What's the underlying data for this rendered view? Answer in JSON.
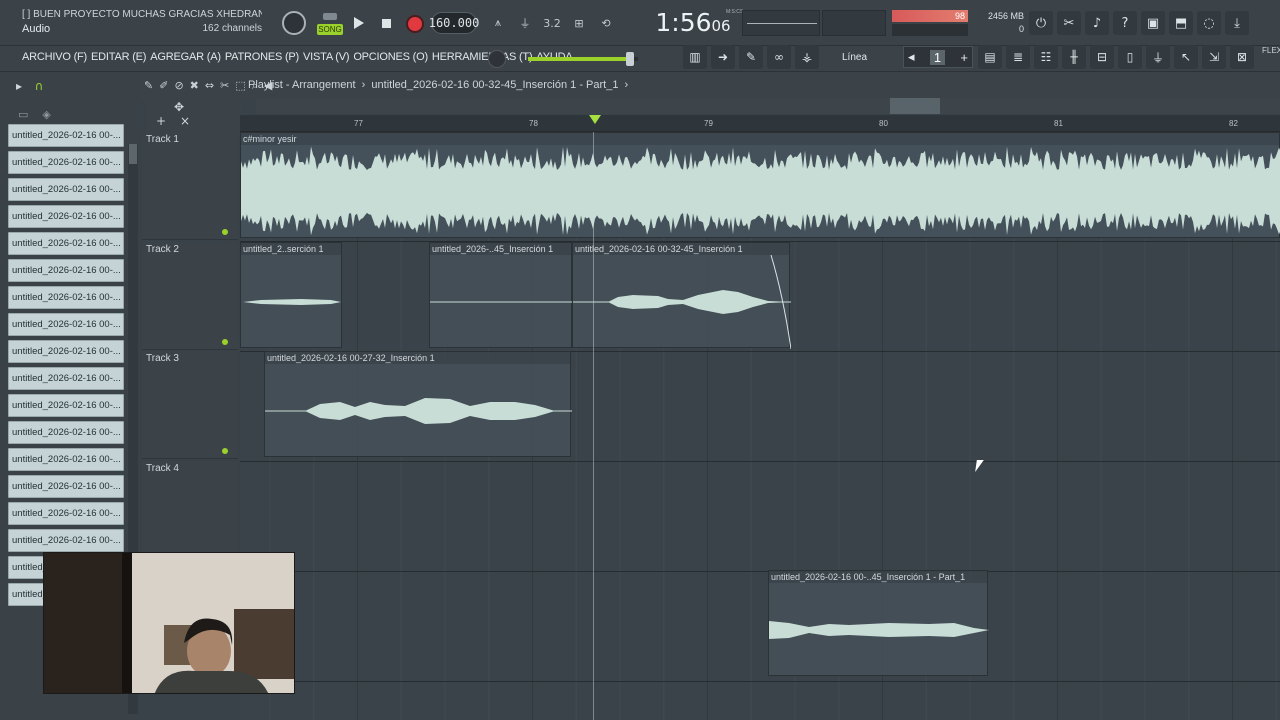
{
  "hint": {
    "line1": "[  ]  BUEN PROYECTO MUCHAS GRACIAS XHEDRAN.",
    "kind": "Audio",
    "channels": "162 channels"
  },
  "transport": {
    "mode_label": "SONG",
    "tempo": "160.000",
    "time_main": "1:56",
    "time_sub": "06",
    "time_unit": "M:S:CS"
  },
  "status": {
    "cpu_value": "98",
    "memory": "2456 MB",
    "polyphony": "0"
  },
  "menu": {
    "items": [
      "ARCHIVO (F)",
      "EDITAR (E)",
      "AGREGAR (A)",
      "PATRONES (P)",
      "VISTA (V)",
      "OPCIONES (O)",
      "HERRAMIENTAS (T)",
      "AYUDA"
    ]
  },
  "snap": {
    "label": "Línea",
    "step_value": "1"
  },
  "flex_label": "FLEX",
  "playlist": {
    "title": "Playlist - Arrangement",
    "breadcrumb": "untitled_2026-02-16 00-32-45_Inserción 1 - Part_1"
  },
  "browser": {
    "items": [
      "untitled_2026-02-16 00-...",
      "untitled_2026-02-16 00-...",
      "untitled_2026-02-16 00-...",
      "untitled_2026-02-16 00-...",
      "untitled_2026-02-16 00-...",
      "untitled_2026-02-16 00-...",
      "untitled_2026-02-16 00-...",
      "untitled_2026-02-16 00-...",
      "untitled_2026-02-16 00-...",
      "untitled_2026-02-16 00-...",
      "untitled_2026-02-16 00-...",
      "untitled_2026-02-16 00-...",
      "untitled_2026-02-16 00-...",
      "untitled_2026-02-16 00-...",
      "untitled_2026-02-16 00-...",
      "untitled_2026-02-16 00-...",
      "untitled_2026-02-16 00-...",
      "untitled_2026-02-16 00-..."
    ]
  },
  "ruler": {
    "bars": [
      "77",
      "78",
      "79",
      "80",
      "81",
      "82"
    ]
  },
  "tracks": [
    {
      "name": "Track 1"
    },
    {
      "name": "Track 2"
    },
    {
      "name": "Track 3"
    },
    {
      "name": "Track 4"
    },
    {
      "name": ""
    }
  ],
  "clips": [
    {
      "label": "c#minor yesir"
    },
    {
      "label": "untitled_2..serción 1"
    },
    {
      "label": "untitled_2026-..45_Inserción 1"
    },
    {
      "label": "untitled_2026-02-16 00-32-45_Inserción 1"
    },
    {
      "label": "untitled_2026-02-16 00-27-32_Inserción 1"
    },
    {
      "label": "untitled_2026-02-16 00-..45_Inserción 1 - Part_1"
    }
  ],
  "colors": {
    "accent": "#9ad22b",
    "record": "#e0393f",
    "cpu": "#d85a5a",
    "clip_wave": "#c8ddd6"
  },
  "icons": [
    "play-icon",
    "stop-icon",
    "record-icon",
    "metronome-icon",
    "mixer-icon",
    "channel-rack-icon",
    "piano-roll-icon",
    "browser-icon",
    "plugin-icon",
    "help-icon",
    "save-icon",
    "download-icon"
  ]
}
